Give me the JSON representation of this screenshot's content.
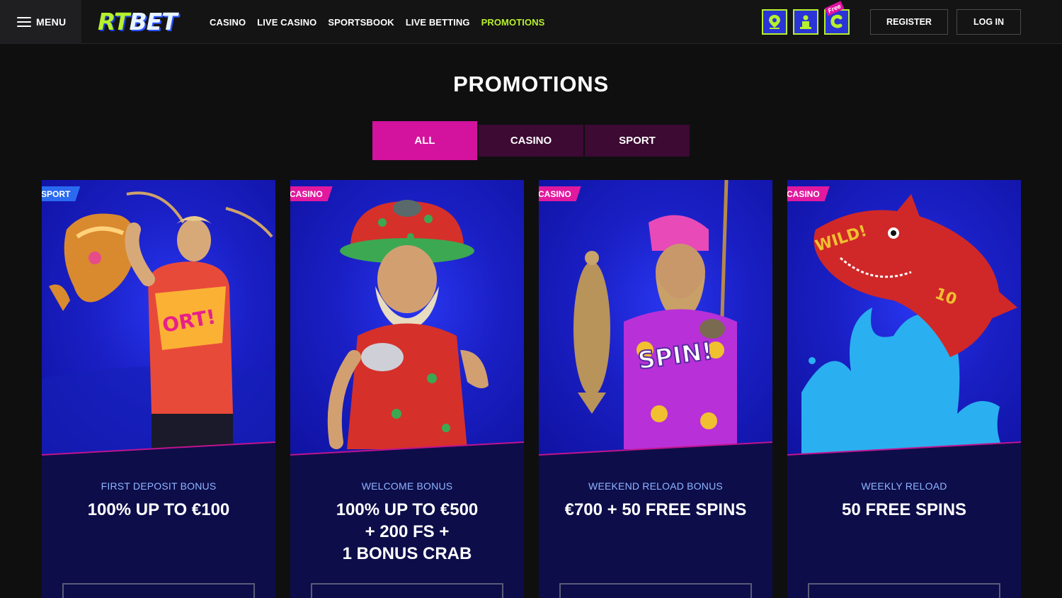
{
  "header": {
    "menu_label": "MENU",
    "logo": {
      "part1": "RT",
      "part2": "BET"
    },
    "nav": [
      {
        "label": "CASINO",
        "active": false
      },
      {
        "label": "LIVE CASINO",
        "active": false
      },
      {
        "label": "SPORTSBOOK",
        "active": false
      },
      {
        "label": "LIVE BETTING",
        "active": false
      },
      {
        "label": "PROMOTIONS",
        "active": true
      }
    ],
    "icons": [
      "map-pin-icon",
      "support-agent-icon",
      "free-coin-icon"
    ],
    "free_tag": "Free",
    "register_label": "REGISTER",
    "login_label": "LOG IN"
  },
  "page": {
    "title": "PROMOTIONS",
    "tabs": [
      {
        "label": "ALL",
        "active": true
      },
      {
        "label": "CASINO",
        "active": false
      },
      {
        "label": "SPORT",
        "active": false
      }
    ]
  },
  "cards": [
    {
      "badge": "SPORT",
      "subtitle": "FIRST DEPOSIT BONUS",
      "title": "100% UP TO €100",
      "art": "footballer-trophy"
    },
    {
      "badge": "CASINO",
      "subtitle": "WELCOME BONUS",
      "title": "100% UP TO €500\n+ 200 FS +\n1 BONUS CRAB",
      "art": "old-man-hat"
    },
    {
      "badge": "CASINO",
      "subtitle": "WEEKEND RELOAD BONUS",
      "title": "€700 + 50 FREE SPINS",
      "art": "fisherman"
    },
    {
      "badge": "CASINO",
      "subtitle": "WEEKLY RELOAD",
      "title": "50 FREE SPINS",
      "art": "shark"
    }
  ],
  "colors": {
    "accent_green": "#b8f22c",
    "accent_pink": "#d3129e",
    "tab_inactive": "#3c0a33",
    "card_bg": "#0d0d4a",
    "sport_badge": "#2a6af0",
    "casino_badge": "#e2199e"
  }
}
